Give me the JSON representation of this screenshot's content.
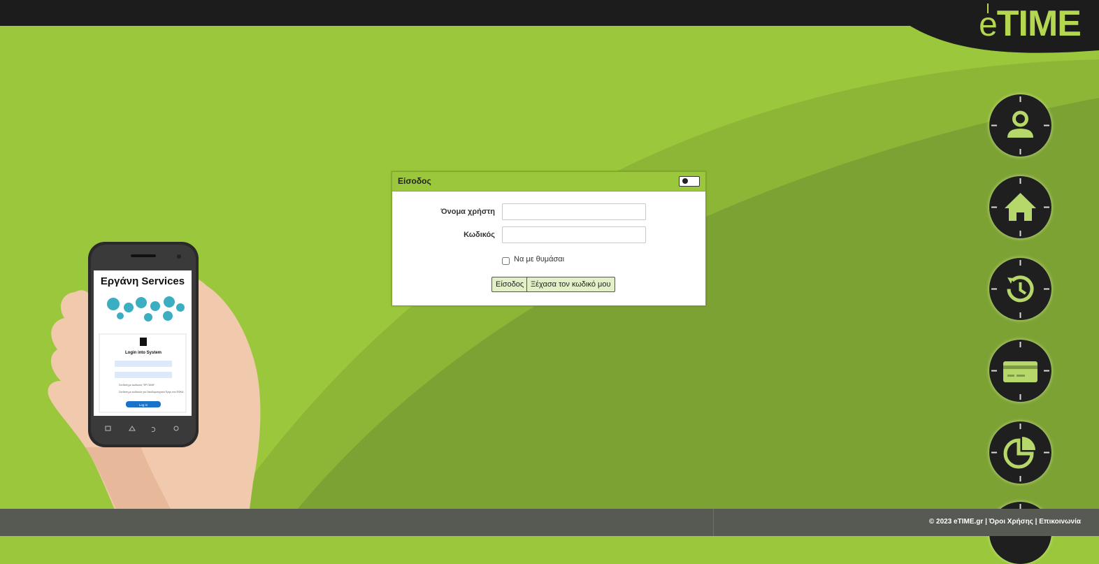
{
  "brand": {
    "logo_text": "TIME",
    "logo_prefix": "e"
  },
  "login": {
    "title": "Είσοδος",
    "username_label": "Όνομα χρήστη",
    "password_label": "Κωδικός",
    "username_value": "",
    "password_value": "",
    "remember_label": "Να με θυμάσαι",
    "submit_label": "Είσοδος",
    "forgot_label": "Ξέχασα τον κωδικό μου"
  },
  "side_nav": [
    {
      "icon": "user-icon"
    },
    {
      "icon": "home-icon"
    },
    {
      "icon": "history-clock-icon"
    },
    {
      "icon": "card-icon"
    },
    {
      "icon": "pie-chart-icon"
    }
  ],
  "phone": {
    "app_title": "Εργάνη Services",
    "screen_heading": "Login into System",
    "option1": "Σύνδεση με κωδικούς \"ΕΡ ΓΑΝΗ\"",
    "option2": "Σύνδεση με κωδικούς για Οικοδομοτεχνικό Έργο στο ΕΦΚΑ",
    "button": "Log in"
  },
  "footer": {
    "copyright": "© 2023 eTIME.gr",
    "sep": "|",
    "terms": "Όροι Χρήσης",
    "contact": "Επικοινωνία"
  },
  "colors": {
    "accent": "#9ac73c",
    "dark_green": "#7ea33a",
    "topbar": "#1c1c1c",
    "footer": "#565a52"
  }
}
